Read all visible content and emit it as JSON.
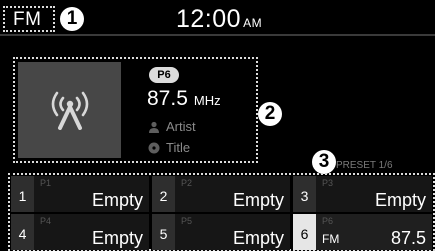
{
  "header": {
    "mode": "FM",
    "time": "12:00",
    "ampm": "AM"
  },
  "callouts": [
    "1",
    "2",
    "3"
  ],
  "now_playing": {
    "preset_badge": "P6",
    "frequency": "87.5",
    "unit": "MHz",
    "artist": "Artist",
    "title": "Title",
    "icon": "radio-antenna-icon"
  },
  "preset_status": "PRESET 1/6",
  "presets": [
    {
      "number": "1",
      "tag": "P1",
      "name": "Empty",
      "active": false
    },
    {
      "number": "2",
      "tag": "P2",
      "name": "Empty",
      "active": false
    },
    {
      "number": "3",
      "tag": "P3",
      "name": "Empty",
      "active": false
    },
    {
      "number": "4",
      "tag": "P4",
      "name": "Empty",
      "active": false
    },
    {
      "number": "5",
      "tag": "P5",
      "name": "Empty",
      "active": false
    },
    {
      "number": "6",
      "tag": "P6",
      "band": "FM",
      "name": "87.5",
      "active": true
    }
  ]
}
